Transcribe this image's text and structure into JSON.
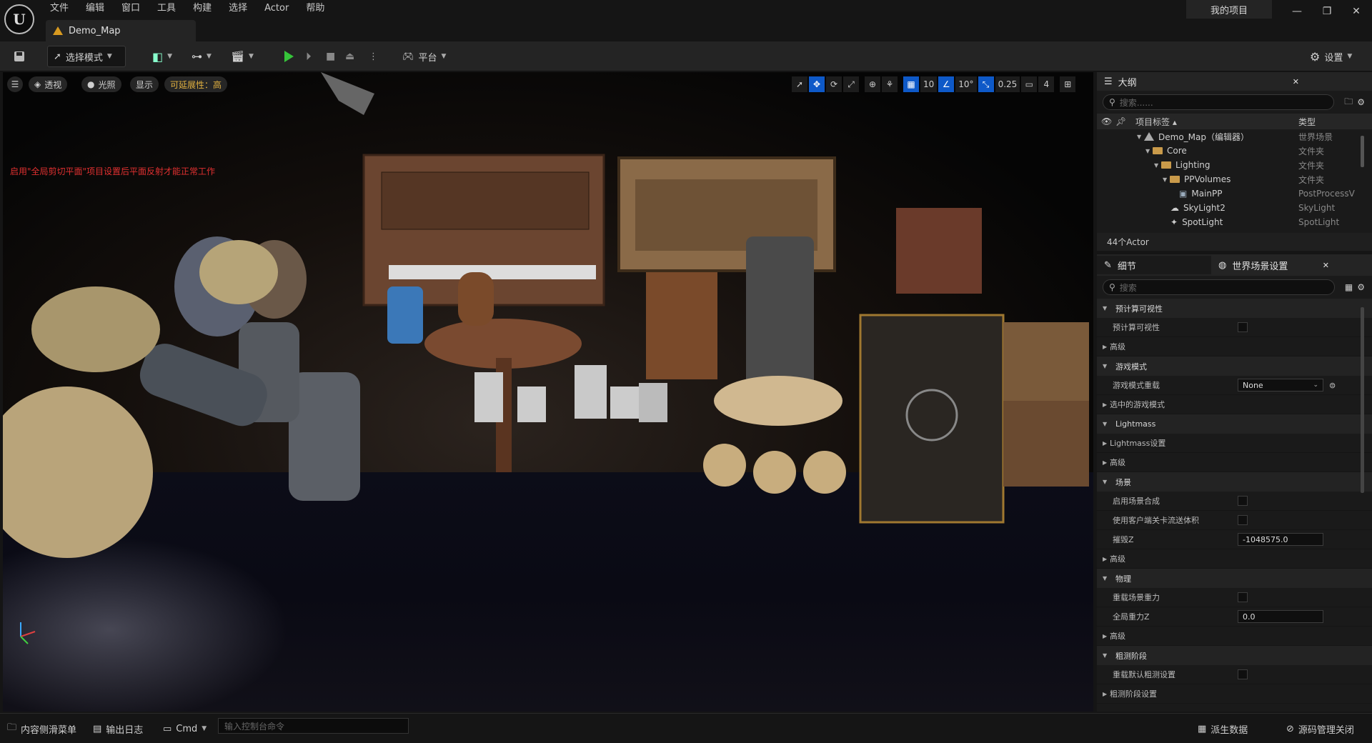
{
  "menu": [
    "文件",
    "编辑",
    "窗口",
    "工具",
    "构建",
    "选择",
    "Actor",
    "帮助"
  ],
  "map_tab": "Demo_Map",
  "project_name": "我的项目",
  "toolbar": {
    "mode_label": "选择模式",
    "platform_label": "平台",
    "settings_label": "设置"
  },
  "viewport": {
    "perspective": "透视",
    "lighting": "光照",
    "show": "显示",
    "scalability": "可延展性：高",
    "warning": "启用\"全局剪切平面\"项目设置后平面反射才能正常工作",
    "grid_snap": "10",
    "rotation_snap": "10°",
    "scale_snap": "0.25",
    "camera_speed": "4"
  },
  "outliner": {
    "tab": "大纲",
    "search_placeholder": "搜索......",
    "col_label": "项目标签",
    "col_type": "类型",
    "rows": [
      {
        "label": "Demo_Map（编辑器）",
        "type": "世界场景"
      },
      {
        "label": "Core",
        "type": "文件夹"
      },
      {
        "label": "Lighting",
        "type": "文件夹"
      },
      {
        "label": "PPVolumes",
        "type": "文件夹"
      },
      {
        "label": "MainPP",
        "type": "PostProcessV"
      },
      {
        "label": "SkyLight2",
        "type": "SkyLight"
      },
      {
        "label": "SpotLight",
        "type": "SpotLight"
      }
    ],
    "actor_count": "44个Actor"
  },
  "details": {
    "tab_details": "细节",
    "tab_world": "世界场景设置",
    "search_placeholder": "搜索",
    "items": [
      {
        "kind": "cat",
        "label": "预计算可视性"
      },
      {
        "kind": "prop",
        "label": "预计算可视性",
        "value": "check"
      },
      {
        "kind": "sub",
        "label": "高级"
      },
      {
        "kind": "cat",
        "label": "游戏模式"
      },
      {
        "kind": "prop",
        "label": "游戏模式重载",
        "value": "None"
      },
      {
        "kind": "sub",
        "label": "选中的游戏模式"
      },
      {
        "kind": "cat",
        "label": "Lightmass"
      },
      {
        "kind": "sub",
        "label": "Lightmass设置"
      },
      {
        "kind": "sub",
        "label": "高级"
      },
      {
        "kind": "cat",
        "label": "场景"
      },
      {
        "kind": "prop",
        "label": "启用场景合成",
        "value": "check"
      },
      {
        "kind": "prop",
        "label": "使用客户端关卡流送体积",
        "value": "check"
      },
      {
        "kind": "prop",
        "label": "摧毁Z",
        "value": "-1048575.0"
      },
      {
        "kind": "sub",
        "label": "高级"
      },
      {
        "kind": "cat",
        "label": "物理"
      },
      {
        "kind": "prop",
        "label": "重载场景重力",
        "value": "check"
      },
      {
        "kind": "prop",
        "label": "全局重力Z",
        "value": "0.0"
      },
      {
        "kind": "sub",
        "label": "高级"
      },
      {
        "kind": "cat",
        "label": "粗测阶段"
      },
      {
        "kind": "prop",
        "label": "重载默认粗测设置",
        "value": "check"
      },
      {
        "kind": "sub",
        "label": "粗测阶段设置"
      }
    ]
  },
  "statusbar": {
    "content_drawer": "内容侧滑菜单",
    "output_log": "输出日志",
    "cmd": "Cmd",
    "console_placeholder": "输入控制台命令",
    "derived_data": "派生数据",
    "source_control": "源码管理关闭"
  },
  "colors": {
    "accent_blue": "#0e59c8",
    "play_green": "#36c43a",
    "warning_red": "#e03030",
    "folder": "#c99a4a"
  }
}
